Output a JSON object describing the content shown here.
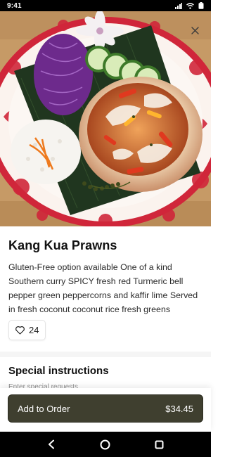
{
  "status_bar": {
    "time": "9:41",
    "icons": [
      "signal-icon",
      "wifi-icon",
      "battery-icon"
    ]
  },
  "hero": {
    "image_description": "Kang Kua Prawns dish in coconut shell on banana leaf",
    "close_icon": "close-icon"
  },
  "item": {
    "title": "Kang Kua Prawns",
    "description": "Gluten-Free option available One of a kind Southern curry SPICY fresh red Turmeric bell pepper green peppercorns and kaffir lime Served in fresh coconut coconut rice fresh greens",
    "likes": "24",
    "like_icon": "heart-icon"
  },
  "special_instructions": {
    "title": "Special instructions",
    "placeholder": "Enter special requests"
  },
  "order": {
    "label": "Add to Order",
    "price": "$34.45"
  },
  "nav": {
    "icons": [
      "back-icon",
      "home-icon",
      "recents-icon"
    ]
  },
  "colors": {
    "order_button": "#3f3f2f",
    "plate_red": "#d0263a",
    "background": "#ffffff"
  }
}
